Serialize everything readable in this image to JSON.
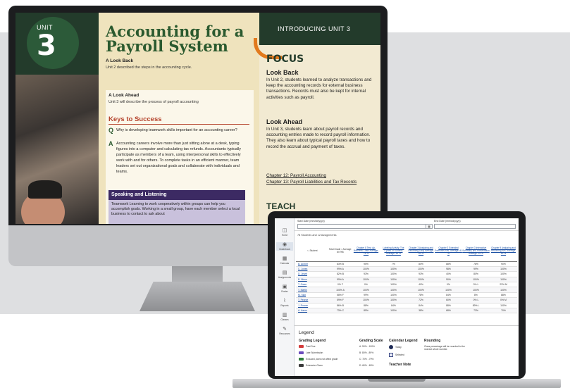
{
  "book": {
    "unit_label": "UNIT",
    "unit_number": "3",
    "title_line1": "Accounting for a",
    "title_line2": "Payroll System",
    "look_back_heading": "A Look Back",
    "look_back_text": "Unit 2 described the steps in the accounting cycle.",
    "look_ahead_heading": "A Look Ahead",
    "look_ahead_text": "Unit 3 will describe the process of payroll accounting",
    "keys_heading": "Keys to Success",
    "q_letter": "Q",
    "q_text": "Why is developing teamwork skills important for an accounting career?",
    "a_letter": "A",
    "a_text": "Accounting careers involve more than just sitting alone at a desk, typing figures into a computer and calculating tax refunds. Accountants typically participate as members of a team, using interpersonal skills to effectively work with and for others. To complete tasks in an efficient manner, team leaders set out organizational goals and collaborate with individuals and teams.",
    "speaking_heading": "Speaking and Listening",
    "speaking_text": "Teamwork Learning to work cooperatively within groups can help you accomplish goals. Working in a small group, have each member select a local business to contact to ask about",
    "intro_band": "INTRODUCING UNIT 3",
    "focus": "FOCUS",
    "rb_look_back": "Look Back",
    "rb_look_back_text": "In Unit 2, students learned to analyze transactions and keep the accounting records for external business transactions. Records must also be kept for internal activities such as payroll.",
    "rb_look_ahead": "Look Ahead",
    "rb_look_ahead_text": "In Unit 3, students learn about payroll records and accounting entries made to record payroll information. They also learn about typical payroll taxes and how to record the accrual and payment of taxes.",
    "ch12": "Chapter 12: Payroll Accounting",
    "ch13": "Chapter 13: Payroll Liabilities and Tax Records",
    "teach": "TEACH"
  },
  "app": {
    "start_date_label": "Start Date (mm/dd/yyyy)",
    "end_date_label": "End Date (mm/dd/yyyy)",
    "calendar_icon": "calendar-icon",
    "count_text": "78 Students and 12 Assignments",
    "sidebar": [
      {
        "label": "Home",
        "icon": "◫"
      },
      {
        "label": "Gradebook",
        "icon": "◉"
      },
      {
        "label": "Calendar",
        "icon": "▦"
      },
      {
        "label": "Assignments",
        "icon": "▤"
      },
      {
        "label": "Roster",
        "icon": "▣"
      },
      {
        "label": "Reports",
        "icon": "⌇"
      },
      {
        "label": "Classes",
        "icon": "▥"
      },
      {
        "label": "Resources",
        "icon": "✎"
      }
    ],
    "columns": [
      "↑↓ Student",
      "Total Grade ↕ Average: 80 %B",
      "Chapter 8 Test: Ap-Business Class Average: 78 %",
      "Labeling Activity: The Cycles of Success Average: 83 %",
      "Chapter 3 Analyzing and Recording Daily Average: 83 %",
      "Chapter 3 Extended Exercises Ans. Average: 81 %",
      "Chapter 3 Interactive Summary and Presentation Average: 54 %",
      "Chapter 9 Analyzing and Recording Ans. Average: 83 %"
    ],
    "rows": [
      {
        "student": "B. Archer",
        "cells": [
          "83% B",
          "95%",
          "7%",
          "80%",
          "88%",
          "78%",
          "90%"
        ]
      },
      {
        "student": "C. Jones",
        "cells": [
          "99% A",
          "100%",
          "100%",
          "100%",
          "98%",
          "99%",
          "100%"
        ]
      },
      {
        "student": "D. Jewel",
        "cells": [
          "82% B",
          "93%",
          "100%",
          "93%",
          "40%",
          "80%",
          "100%"
        ]
      },
      {
        "student": "B. Nixon",
        "cells": [
          "99% A",
          "100%",
          "100%",
          "100%",
          "90%",
          "100%",
          "100%"
        ]
      },
      {
        "student": "T. Owen",
        "cells": [
          "0% F",
          "0%",
          "100%",
          "40%",
          "0%",
          "0% L",
          "23% M"
        ]
      },
      {
        "student": "T. Martin",
        "cells": [
          "100% A",
          "100%",
          "100%",
          "100%",
          "100%",
          "100%",
          "100%"
        ]
      },
      {
        "student": "M. Max",
        "cells": [
          "58% F",
          "99%",
          "100%",
          "78%",
          "84%",
          "8%",
          "88%"
        ]
      },
      {
        "student": "T. Pearce",
        "cells": [
          "59% F",
          "100%",
          "100%",
          "72%",
          "60%",
          "0% L",
          "0% M"
        ]
      },
      {
        "student": "J. Rowan",
        "cells": [
          "86% B",
          "88%",
          "84%",
          "84%",
          "88%",
          "89% L",
          "100%"
        ]
      },
      {
        "student": "A. Aaron",
        "cells": [
          "73% C",
          "85%",
          "100%",
          "38%",
          "68%",
          "73%",
          "70%"
        ]
      }
    ],
    "legend": {
      "title": "Legend",
      "grading_legend": "Grading Legend",
      "grading_items": [
        "Past Due",
        "Late Submission",
        "Excused, does not affect grade",
        "Extension Given"
      ],
      "grading_colors": [
        "#d23a3a",
        "#6b4bbd",
        "#2f7d3c",
        "#3a3a3a"
      ],
      "grading_scale": "Grading Scale",
      "scale_items": [
        "A: 90% - 100%",
        "B: 80% - 89%",
        "C: 70% - 79%",
        "D: 60% - 69%"
      ],
      "calendar_legend": "Calendar Legend",
      "calendar_items": [
        "Today",
        "Selected"
      ],
      "rounding": "Rounding",
      "rounding_text": "Class percentage will be rounded to the nearest whole number.",
      "teacher_note": "Teacher Note"
    }
  }
}
